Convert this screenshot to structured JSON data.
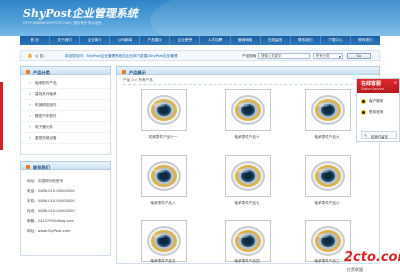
{
  "header": {
    "logo": "ShyPost企业管理系统",
    "subtitle": "HTTP://WWW.SHYPOST.COM | 团为专业·所以出色"
  },
  "nav": [
    "首 页",
    "关于我们",
    "企业简介",
    "公司新闻",
    "产品展示",
    "企业荣誉",
    "人才招聘",
    "营销网络",
    "在线留言",
    "联系我们",
    "下载中心",
    "联系我们"
  ],
  "notice": {
    "label": "公 告：",
    "text": "欢迎您访问：ShyPost企业管理系统办企业网飞发展(ShyPost企业管理"
  },
  "search": {
    "label": "产品搜索",
    "placeholder": "请输入关键字",
    "select": "所有分类",
    "button": "Go"
  },
  "sidebar": {
    "category_title": "产品分类",
    "categories": [
      "轴承配件产品",
      "直线系列轴承",
      "机械精密部件",
      "模型汽车配件",
      "电子器元件",
      "重型机械设备"
    ],
    "contact_title": "联系我们",
    "contact": [
      "地址：中国阿尔塔西市",
      "电话：0086-010-00000000",
      "手机：0086-010-00000000",
      "传真：0086-010-00000000",
      "邮箱：2414795048qq.com",
      "网址：www.ShyPost.com"
    ]
  },
  "content": {
    "title": "产品展示",
    "breadcrumb": "产品 >> 所有产品",
    "count": "共有 11 个",
    "products": [
      "机械零件产品十一",
      "轴承零件产品十",
      "轴承零件产品九",
      "轴承零件产品八",
      "轴承零件产品七",
      "轴承零件产品六",
      "轴承零件产品五",
      "轴承零件产品四",
      "轴承零件产品三"
    ]
  },
  "service": {
    "title": "在线客服",
    "subtitle": "Online Service",
    "close": "×",
    "items": [
      "客户服务",
      "售前咨询"
    ],
    "message": "给我们留言"
  },
  "watermark": {
    "text": "2cto.com",
    "subtitle": "红黑联盟"
  },
  "colors": {
    "header": "#3a8fd2",
    "nav": "#1f66aa",
    "accent": "#d2232a",
    "title": "#1c4f84"
  }
}
